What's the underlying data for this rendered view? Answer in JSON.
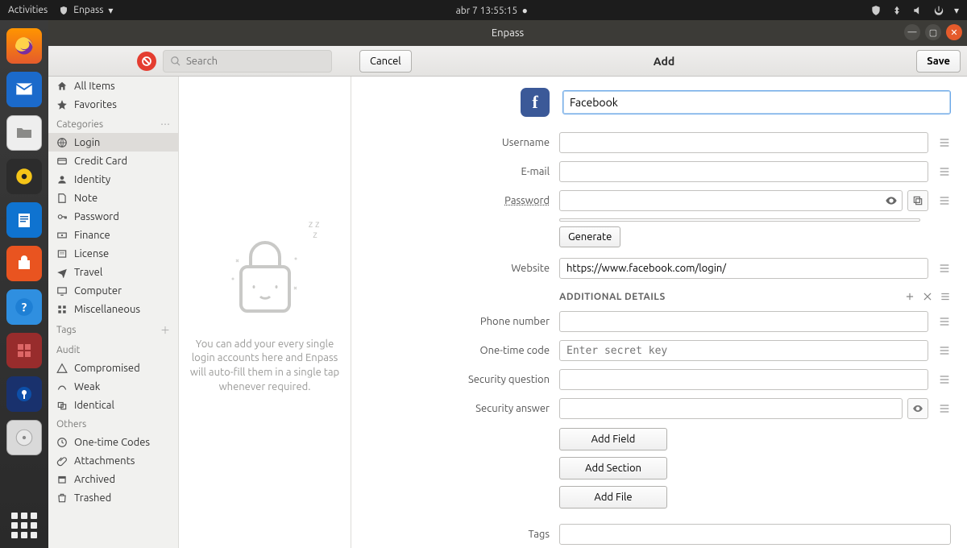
{
  "topbar": {
    "activities": "Activities",
    "app_name": "Enpass",
    "clock": "abr 7  13:55:15"
  },
  "window": {
    "title": "Enpass"
  },
  "toolbar": {
    "search_placeholder": "Search",
    "cancel": "Cancel",
    "title": "Add",
    "save": "Save"
  },
  "sidebar": {
    "top": [
      {
        "label": "All Items"
      },
      {
        "label": "Favorites"
      }
    ],
    "head_categories": "Categories",
    "categories": [
      {
        "label": "Login",
        "selected": true
      },
      {
        "label": "Credit Card"
      },
      {
        "label": "Identity"
      },
      {
        "label": "Note"
      },
      {
        "label": "Password"
      },
      {
        "label": "Finance"
      },
      {
        "label": "License"
      },
      {
        "label": "Travel"
      },
      {
        "label": "Computer"
      },
      {
        "label": "Miscellaneous"
      }
    ],
    "head_tags": "Tags",
    "head_audit": "Audit",
    "audit": [
      {
        "label": "Compromised"
      },
      {
        "label": "Weak"
      },
      {
        "label": "Identical"
      }
    ],
    "head_others": "Others",
    "others": [
      {
        "label": "One-time Codes"
      },
      {
        "label": "Attachments"
      },
      {
        "label": "Archived"
      },
      {
        "label": "Trashed"
      }
    ]
  },
  "empty_hint": "You can add your every single login accounts here and Enpass will auto-fill them in a single tap whenever required.",
  "form": {
    "title_value": "Facebook",
    "labels": {
      "username": "Username",
      "email": "E-mail",
      "password": "Password",
      "generate": "Generate",
      "website": "Website",
      "additional": "ADDITIONAL DETAILS",
      "phone": "Phone number",
      "otp": "One-time code",
      "otp_placeholder": "Enter secret key",
      "secq": "Security question",
      "seca": "Security answer",
      "add_field": "Add Field",
      "add_section": "Add Section",
      "add_file": "Add File",
      "tags": "Tags"
    },
    "values": {
      "username": "",
      "email": "",
      "password": "",
      "website": "https://www.facebook.com/login/",
      "phone": "",
      "otp": "",
      "secq": "",
      "seca": "",
      "tags": ""
    }
  }
}
